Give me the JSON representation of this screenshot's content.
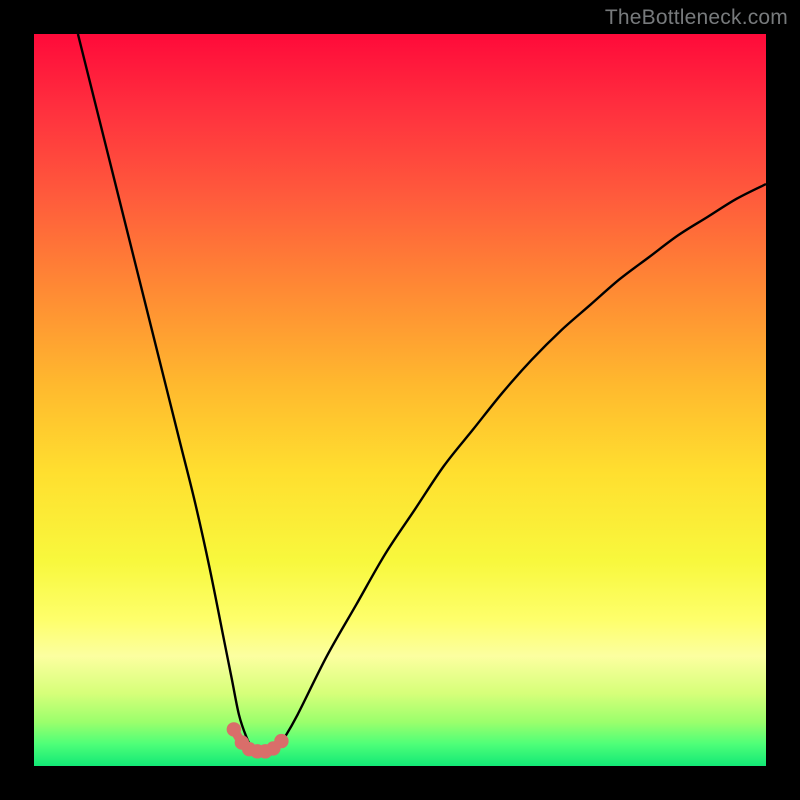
{
  "watermark": "TheBottleneck.com",
  "chart_data": {
    "type": "line",
    "title": "",
    "xlabel": "",
    "ylabel": "",
    "xlim": [
      0,
      100
    ],
    "ylim": [
      0,
      100
    ],
    "grid": false,
    "legend": false,
    "note": "V-shaped bottleneck curve over rainbow gradient; x and y are normalized 0–100 since no axis ticks are visible; y ≈ 0 near the minimum, y ≈ 100 at the top edge.",
    "series": [
      {
        "name": "bottleneck-curve",
        "x": [
          6,
          8,
          10,
          12,
          14,
          16,
          18,
          20,
          22,
          24,
          26,
          27,
          28,
          29,
          30,
          31,
          32,
          33,
          34,
          36,
          40,
          44,
          48,
          52,
          56,
          60,
          64,
          68,
          72,
          76,
          80,
          84,
          88,
          92,
          96,
          100
        ],
        "y": [
          100,
          92,
          84,
          76,
          68,
          60,
          52,
          44,
          36,
          27,
          17,
          12,
          7,
          4,
          2,
          1.5,
          1.5,
          2,
          3.5,
          7,
          15,
          22,
          29,
          35,
          41,
          46,
          51,
          55.5,
          59.5,
          63,
          66.5,
          69.5,
          72.5,
          75,
          77.5,
          79.5
        ]
      },
      {
        "name": "marker-dots",
        "x": [
          27.3,
          28.4,
          29.4,
          30.5,
          31.6,
          32.7,
          33.8
        ],
        "y": [
          5.0,
          3.2,
          2.3,
          2.0,
          2.0,
          2.4,
          3.4
        ]
      }
    ],
    "gradient_stops": [
      {
        "offset": 0.0,
        "color": "#ff0a3a"
      },
      {
        "offset": 0.1,
        "color": "#ff2f3e"
      },
      {
        "offset": 0.22,
        "color": "#ff5a3c"
      },
      {
        "offset": 0.35,
        "color": "#ff8a34"
      },
      {
        "offset": 0.48,
        "color": "#ffb92e"
      },
      {
        "offset": 0.6,
        "color": "#ffdf2f"
      },
      {
        "offset": 0.72,
        "color": "#f8f83d"
      },
      {
        "offset": 0.8,
        "color": "#feff6b"
      },
      {
        "offset": 0.85,
        "color": "#fcffa0"
      },
      {
        "offset": 0.9,
        "color": "#d7ff7a"
      },
      {
        "offset": 0.94,
        "color": "#9bff6c"
      },
      {
        "offset": 0.97,
        "color": "#4eff78"
      },
      {
        "offset": 1.0,
        "color": "#12e876"
      }
    ],
    "curve_color": "#000000",
    "marker_color": "#d96e6a",
    "marker_connector_color": "#d96e6a"
  }
}
